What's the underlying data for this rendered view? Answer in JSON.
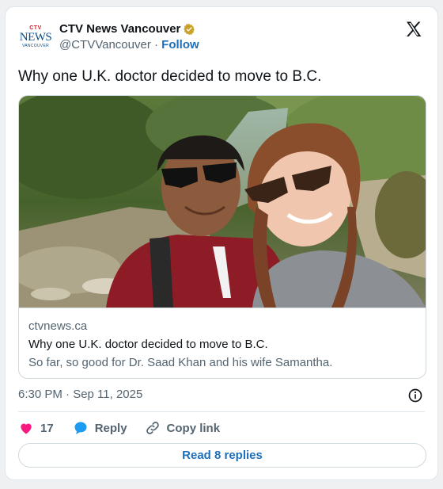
{
  "account": {
    "logo_ctv": "CTV",
    "logo_news": "NEWS",
    "logo_city": "VANCOUVER",
    "display_name": "CTV News Vancouver",
    "handle": "@CTVVancouver",
    "separator": " · ",
    "follow_label": "Follow",
    "verified_badge_color": "#c9a227"
  },
  "tweet": {
    "text": "Why one U.K. doctor decided to move to B.C."
  },
  "link_card": {
    "domain": "ctvnews.ca",
    "title": "Why one U.K. doctor decided to move to B.C.",
    "description": "So far, so good for Dr. Saad Khan and his wife Samantha."
  },
  "meta": {
    "timestamp": "6:30 PM · Sep 11, 2025"
  },
  "actions": {
    "like_count": "17",
    "reply_label": "Reply",
    "copy_link_label": "Copy link"
  },
  "read_replies_label": "Read 8 replies",
  "colors": {
    "heart": "#f91880",
    "reply_bubble": "#1d9bf0",
    "link_blue": "#1d6fb8"
  },
  "icons": [
    "x-logo-icon",
    "verified-badge-icon",
    "heart-icon",
    "reply-bubble-icon",
    "link-chain-icon",
    "info-icon"
  ]
}
